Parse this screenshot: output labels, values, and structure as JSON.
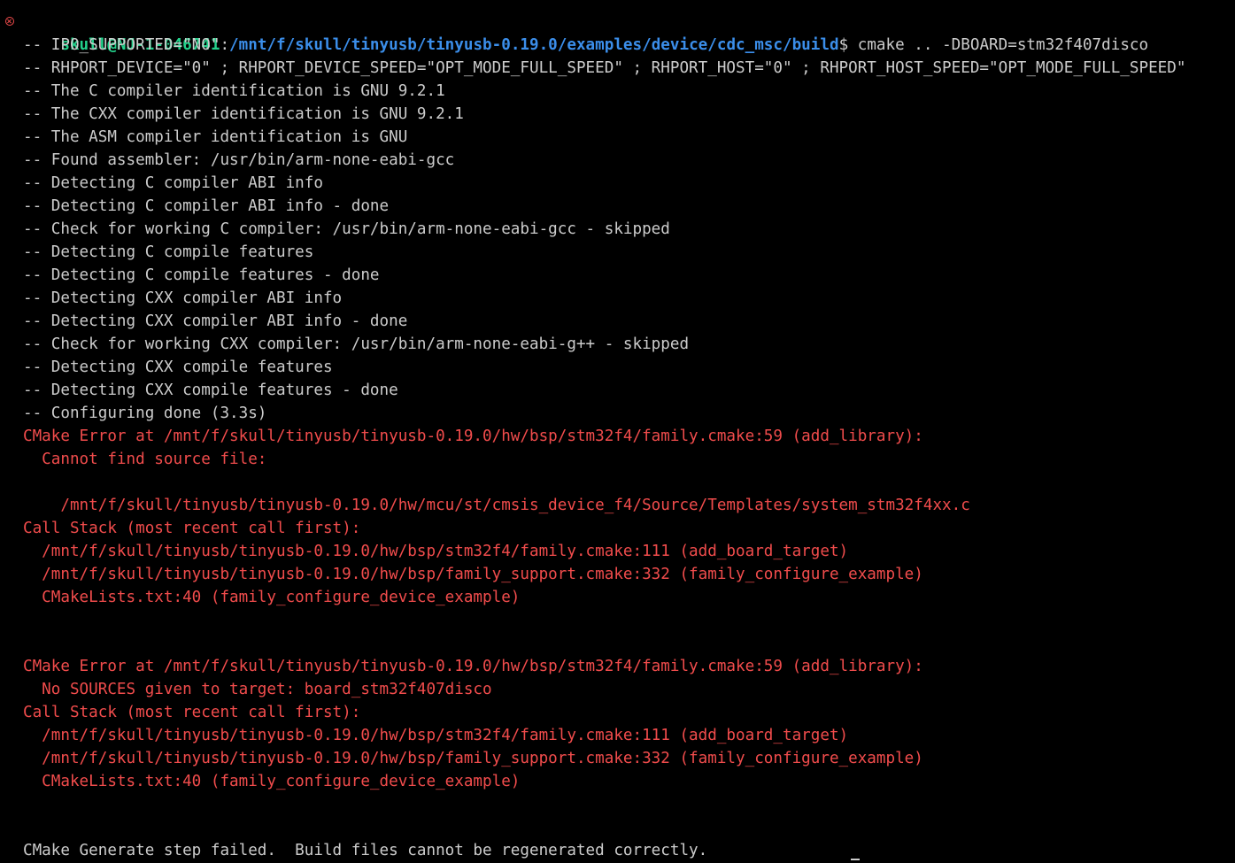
{
  "prompt": {
    "user_host": "skull@NJ-1-046741",
    "separator": ":",
    "cwd": "/mnt/f/skull/tinyusb/tinyusb-0.19.0/examples/device/cdc_msc/build",
    "symbol": "$",
    "command": " cmake .. -DBOARD=stm32f407disco"
  },
  "output": {
    "info_lines": [
      "-- IPO_SUPPORTED=\"NO\"",
      "-- RHPORT_DEVICE=\"0\" ; RHPORT_DEVICE_SPEED=\"OPT_MODE_FULL_SPEED\" ; RHPORT_HOST=\"0\" ; RHPORT_HOST_SPEED=\"OPT_MODE_FULL_SPEED\"",
      "-- The C compiler identification is GNU 9.2.1",
      "-- The CXX compiler identification is GNU 9.2.1",
      "-- The ASM compiler identification is GNU",
      "-- Found assembler: /usr/bin/arm-none-eabi-gcc",
      "-- Detecting C compiler ABI info",
      "-- Detecting C compiler ABI info - done",
      "-- Check for working C compiler: /usr/bin/arm-none-eabi-gcc - skipped",
      "-- Detecting C compile features",
      "-- Detecting C compile features - done",
      "-- Detecting CXX compiler ABI info",
      "-- Detecting CXX compiler ABI info - done",
      "-- Check for working CXX compiler: /usr/bin/arm-none-eabi-g++ - skipped",
      "-- Detecting CXX compile features",
      "-- Detecting CXX compile features - done",
      "-- Configuring done (3.3s)"
    ],
    "error1": {
      "header": "CMake Error at /mnt/f/skull/tinyusb/tinyusb-0.19.0/hw/bsp/stm32f4/family.cmake:59 (add_library):",
      "message": "  Cannot find source file:",
      "detail": "    /mnt/f/skull/tinyusb/tinyusb-0.19.0/hw/mcu/st/cmsis_device_f4/Source/Templates/system_stm32f4xx.c",
      "stack_header": "Call Stack (most recent call first):",
      "stack": [
        "  /mnt/f/skull/tinyusb/tinyusb-0.19.0/hw/bsp/stm32f4/family.cmake:111 (add_board_target)",
        "  /mnt/f/skull/tinyusb/tinyusb-0.19.0/hw/bsp/family_support.cmake:332 (family_configure_example)",
        "  CMakeLists.txt:40 (family_configure_device_example)"
      ]
    },
    "error2": {
      "header": "CMake Error at /mnt/f/skull/tinyusb/tinyusb-0.19.0/hw/bsp/stm32f4/family.cmake:59 (add_library):",
      "message": "  No SOURCES given to target: board_stm32f407disco",
      "stack_header": "Call Stack (most recent call first):",
      "stack": [
        "  /mnt/f/skull/tinyusb/tinyusb-0.19.0/hw/bsp/stm32f4/family.cmake:111 (add_board_target)",
        "  /mnt/f/skull/tinyusb/tinyusb-0.19.0/hw/bsp/family_support.cmake:332 (family_configure_example)",
        "  CMakeLists.txt:40 (family_configure_device_example)"
      ]
    },
    "final": "CMake Generate step failed.  Build files cannot be regenerated correctly."
  },
  "colors": {
    "background": "#000000",
    "text": "#cccccc",
    "user": "#23d18b",
    "path": "#3b8eea",
    "error": "#f14c4c"
  },
  "icons": {
    "gutter": "error-circle-icon"
  }
}
